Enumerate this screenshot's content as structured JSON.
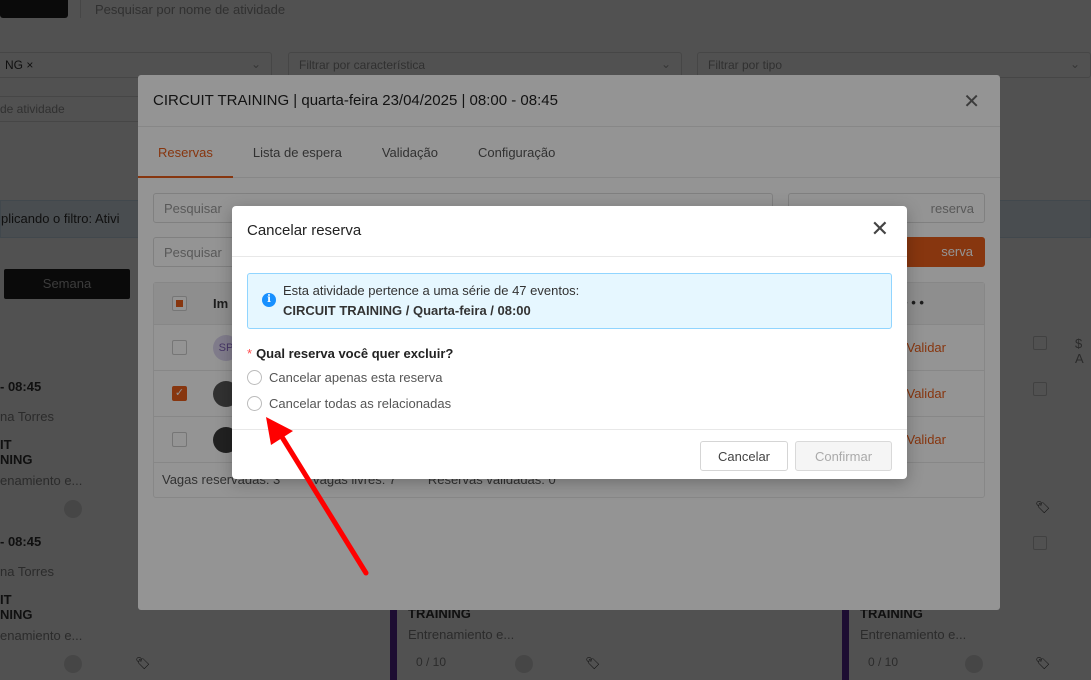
{
  "background": {
    "search_placeholder": "Pesquisar por nome de atividade",
    "filter_selected": "NG ×",
    "filter_characteristic": "Filtrar por característica",
    "filter_type": "Filtrar por tipo",
    "activity_placeholder": "de atividade",
    "applied_filter": "plicando o filtro: Ativi",
    "week_button": "Semana",
    "slot_time": "- 08:45",
    "instructor": "na Torres",
    "class_name_1": "IT",
    "class_name_2": "NING",
    "class_desc": "enamiento e...",
    "training_label": "TRAINING",
    "training_desc": "Entrenamiento e...",
    "capacity": "0 / 10",
    "right_edge": "$ A"
  },
  "modal": {
    "title": "CIRCUIT TRAINING | quarta-feira 23/04/2025 | 08:00 - 08:45",
    "tabs": [
      "Reservas",
      "Lista de espera",
      "Validação",
      "Configuração"
    ],
    "search_placeholder_1": "Pesquisar",
    "search_placeholder_2": "Pesquisar",
    "search_right_placeholder": "reserva",
    "new_reservation_button": "serva",
    "table": {
      "header_image": "Im",
      "header_more": "• • •",
      "rows": [
        {
          "avatar": "SP",
          "action": "Validar"
        },
        {
          "avatar": "",
          "action": "Validar"
        },
        {
          "avatar": "",
          "action": "Validar"
        }
      ],
      "footer_reserved": "Vagas reservadas: 3",
      "footer_free": "Vagas livres: 7",
      "footer_validated": "Reservas validadas: 0"
    }
  },
  "dialog": {
    "title": "Cancelar reserva",
    "info_line1": "Esta atividade pertence a uma série de 47 eventos:",
    "info_line2": "CIRCUIT TRAINING / Quarta-feira / 08:00",
    "question": "Qual reserva você quer excluir?",
    "options": [
      "Cancelar apenas esta reserva",
      "Cancelar todas as relacionadas"
    ],
    "cancel_label": "Cancelar",
    "confirm_label": "Confirmar"
  },
  "colors": {
    "accent": "#e85d1a",
    "info_bg": "#e6f7ff",
    "info_border": "#91d5ff",
    "annotation": "#ff0000"
  }
}
